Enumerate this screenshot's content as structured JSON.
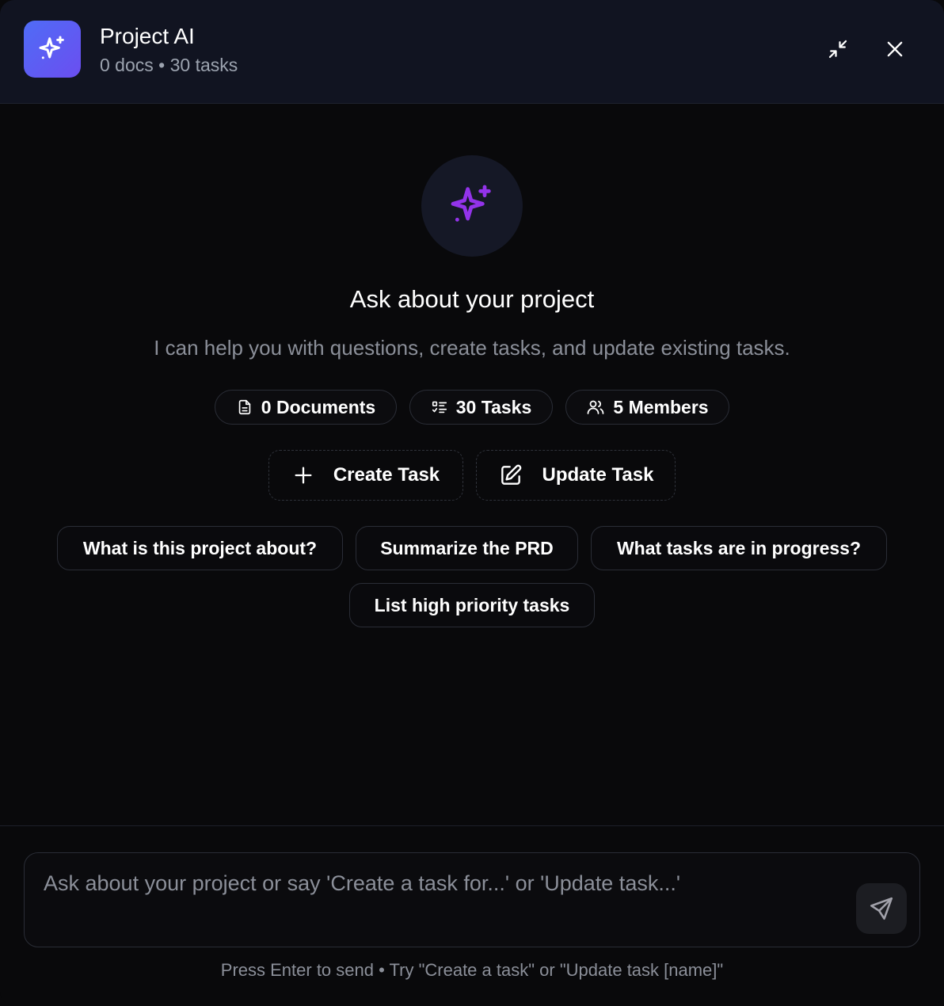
{
  "header": {
    "title": "Project AI",
    "subtitle": "0 docs • 30 tasks",
    "icon": "sparkles-icon",
    "minimize_icon": "minimize-icon",
    "close_icon": "close-icon"
  },
  "hero": {
    "icon": "sparkles-icon",
    "title": "Ask about your project",
    "subtitle": "I can help you with questions, create tasks, and update existing tasks."
  },
  "stats": [
    {
      "icon": "document-icon",
      "label": "0 Documents"
    },
    {
      "icon": "task-list-icon",
      "label": "30 Tasks"
    },
    {
      "icon": "users-icon",
      "label": "5 Members"
    }
  ],
  "actions": [
    {
      "icon": "plus-icon",
      "label": "Create Task"
    },
    {
      "icon": "edit-icon",
      "label": "Update Task"
    }
  ],
  "suggestions": [
    "What is this project about?",
    "Summarize the PRD",
    "What tasks are in progress?",
    "List high priority tasks"
  ],
  "composer": {
    "placeholder": "Ask about your project or say 'Create a task for...' or 'Update task...'",
    "value": "",
    "send_icon": "send-icon",
    "hint": "Press Enter to send • Try \"Create a task\" or \"Update task [name]\""
  },
  "colors": {
    "accent_gradient_start": "#4f6cf6",
    "accent_gradient_end": "#6b4ef0",
    "hero_icon": "#9333ea",
    "background": "#09090b",
    "header_bg": "#111421"
  }
}
